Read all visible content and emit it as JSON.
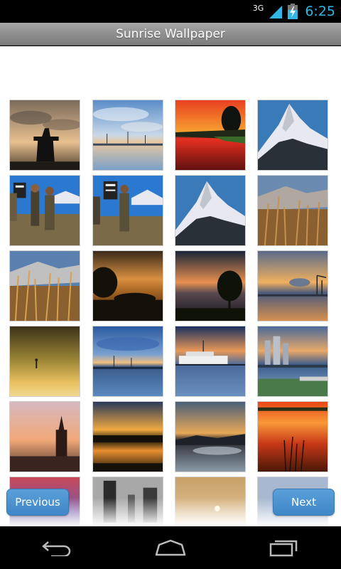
{
  "status_bar": {
    "network": "3G",
    "time": "6:25"
  },
  "title": "Sunrise Wallpaper",
  "buttons": {
    "previous": "Previous",
    "next": "Next"
  },
  "colors": {
    "accent": "#33b5e5",
    "button": "#4a90d0",
    "title_bar": "#999999"
  },
  "thumbnails": [
    "sunrise-inukshuk",
    "harbor-boats-clouds",
    "red-sunset-tree",
    "snowy-mountain-peak",
    "trekkers-with-sign",
    "trekkers-with-sign",
    "snowy-mountain-peak",
    "autumn-shrubs-mountain",
    "autumn-shrubs-mountain",
    "sunset-trees-silhouette",
    "sunset-tree-silhouette",
    "harbor-cranes-sunset",
    "foggy-golden-beach",
    "harbor-boats-reflection",
    "cruise-ship-harbor",
    "city-skyline-waterfront",
    "church-spire-sunset",
    "lake-sunset-reflection",
    "valley-sunrise",
    "red-sky-reeds",
    "purple-sky-sunrise",
    "city-towers-sunrise",
    "golden-haze-sunrise",
    "blue-sky-sunrise"
  ],
  "nav": {
    "back": "back-icon",
    "home": "home-icon",
    "recents": "recents-icon"
  }
}
